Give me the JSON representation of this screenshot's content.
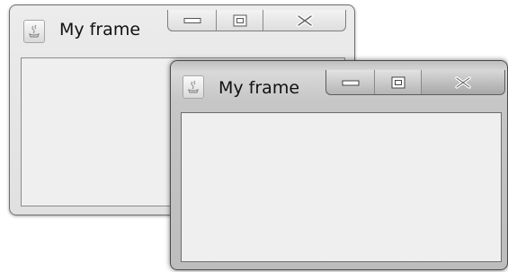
{
  "windows": {
    "back": {
      "title": "My frame",
      "icon": "java-cup-icon",
      "buttons": [
        "minimize",
        "maximize",
        "close"
      ]
    },
    "front": {
      "title": "My frame",
      "icon": "java-cup-icon",
      "buttons": [
        "minimize",
        "maximize",
        "close"
      ]
    }
  }
}
